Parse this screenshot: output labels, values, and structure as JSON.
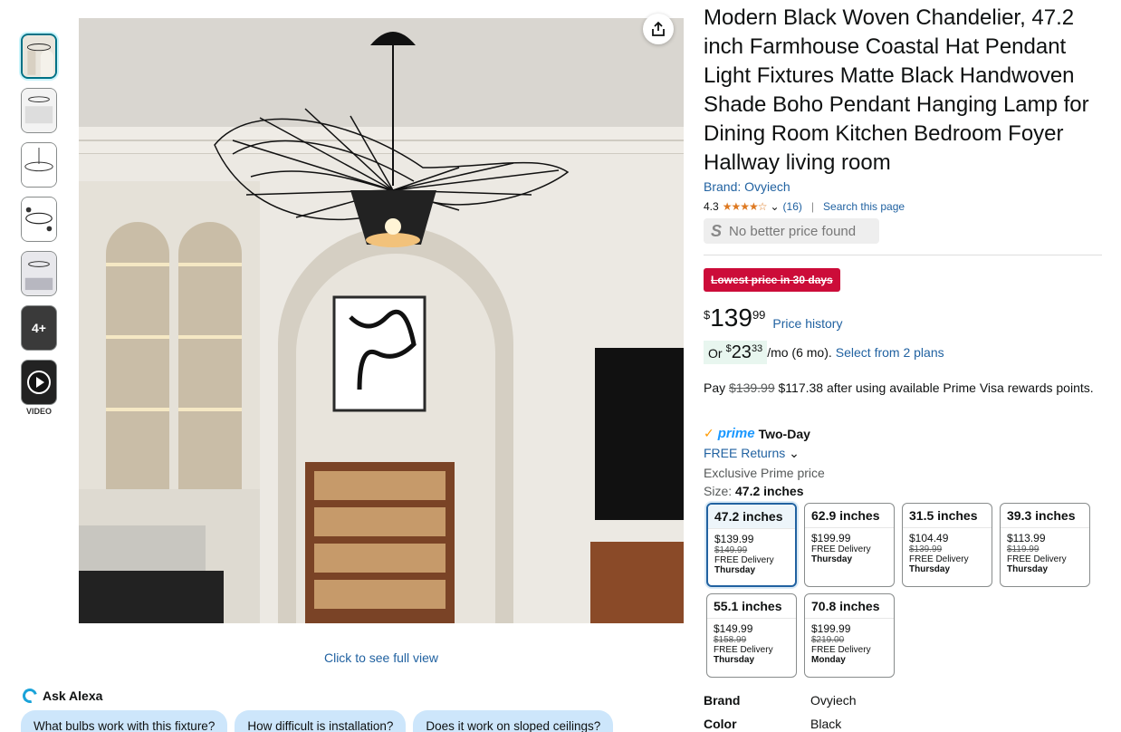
{
  "thumbnails": [
    {
      "label": ""
    },
    {
      "label": ""
    },
    {
      "label": ""
    },
    {
      "label": ""
    },
    {
      "label": ""
    },
    {
      "label": "4+"
    },
    {
      "label": "VIDEO"
    }
  ],
  "main_image": {
    "full_view_link": "Click to see full view"
  },
  "product": {
    "title": "Modern Black Woven Chandelier, 47.2 inch Farmhouse Coastal Hat Pendant Light Fixtures Matte Black Handwoven Shade Boho Pendant Hanging Lamp for Dining Room Kitchen Bedroom Foyer Hallway living room",
    "brand_link": "Brand: Ovyiech",
    "rating": "4.3",
    "review_count": "(16)",
    "search_link": "Search this page",
    "no_better_price": "No better price found",
    "lowest_price_badge": "Lowest price in 30 days",
    "price_symbol": "$",
    "price_whole": "139",
    "price_fraction": "99",
    "price_history_link": "Price history",
    "monthly": {
      "prefix": "Or",
      "symbol": "$",
      "whole": "23",
      "fraction": "33",
      "suffix": "/mo (6 mo).",
      "link": "Select from 2 plans"
    },
    "pay": {
      "prefix": "Pay",
      "old": "$139.99",
      "rest": "$117.38 after using available Prime Visa rewards points."
    },
    "prime": {
      "logo": "prime",
      "shipping": "Two-Day"
    },
    "returns_link": "FREE Returns",
    "exclusive": "Exclusive Prime price",
    "size_label": "Size:",
    "size_value": "47.2 inches"
  },
  "sizes": [
    {
      "name": "47.2 inches",
      "price": "$139.99",
      "was": "$149.99",
      "delivery": "FREE Delivery",
      "day": "Thursday"
    },
    {
      "name": "62.9 inches",
      "price": "$199.99",
      "was": "",
      "delivery": "FREE Delivery",
      "day": "Thursday"
    },
    {
      "name": "31.5 inches",
      "price": "$104.49",
      "was": "$139.99",
      "delivery": "FREE Delivery",
      "day": "Thursday"
    },
    {
      "name": "39.3 inches",
      "price": "$113.99",
      "was": "$119.99",
      "delivery": "FREE Delivery",
      "day": "Thursday"
    },
    {
      "name": "55.1 inches",
      "price": "$149.99",
      "was": "$158.99",
      "delivery": "FREE Delivery",
      "day": "Thursday"
    },
    {
      "name": "70.8 inches",
      "price": "$199.99",
      "was": "$219.00",
      "delivery": "FREE Delivery",
      "day": "Monday"
    }
  ],
  "alexa": {
    "label": "Ask Alexa",
    "chips": [
      "What bulbs work with this fixture?",
      "How difficult is installation?",
      "Does it work on sloped ceilings?"
    ]
  },
  "specs": [
    {
      "key": "Brand",
      "value": "Ovyiech"
    },
    {
      "key": "Color",
      "value": "Black"
    }
  ]
}
